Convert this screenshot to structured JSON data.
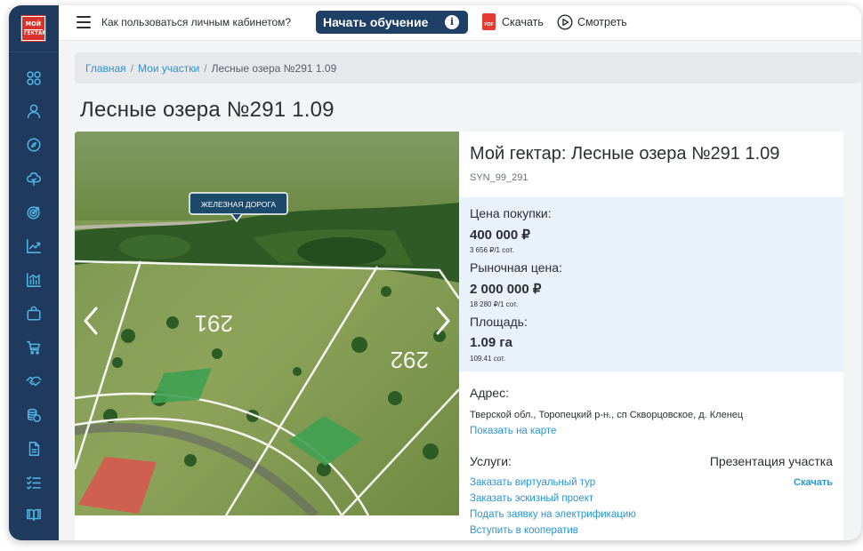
{
  "app": {
    "logo_line1": "МОЙ",
    "logo_line2": "ГЕКТАР",
    "brand_color": "#d9322b",
    "sidebar_color": "#1f3a5c",
    "accent_color": "#2a95d2"
  },
  "sidebar": {
    "items": [
      {
        "icon": "grid-icon"
      },
      {
        "icon": "user-icon"
      },
      {
        "icon": "compass-icon"
      },
      {
        "icon": "tree-icon"
      },
      {
        "icon": "target-icon"
      },
      {
        "icon": "line-chart-icon"
      },
      {
        "icon": "bar-chart-icon"
      },
      {
        "icon": "bag-icon"
      },
      {
        "icon": "cart-icon"
      },
      {
        "icon": "handshake-icon"
      },
      {
        "icon": "coins-icon"
      },
      {
        "icon": "document-icon"
      },
      {
        "icon": "checklist-icon"
      },
      {
        "icon": "book-icon"
      }
    ]
  },
  "topbar": {
    "help_text": "Как пользоваться личным кабинетом?",
    "start_label": "Начать обучение",
    "info_glyph": "i",
    "pdf_badge": "PDF",
    "download_label": "Скачать",
    "watch_label": "Смотреть"
  },
  "breadcrumb": {
    "home": "Главная",
    "my_plots": "Мои участки",
    "current": "Лесные озера №291 1.09",
    "separator": "/"
  },
  "page": {
    "title": "Лесные озера №291 1.09"
  },
  "photo": {
    "sign_label": "ЖЕЛЕЗНАЯ ДОРОГА",
    "plot_a": "291",
    "plot_b": "292"
  },
  "plot": {
    "title": "Мой гектар: Лесные озера №291 1.09",
    "code": "SYN_99_291",
    "purchase_price_label": "Цена покупки:",
    "purchase_price": "400 000 ₽",
    "purchase_per_unit": "3 656 ₽/1 сот.",
    "market_price_label": "Рыночная цена:",
    "market_price": "2 000 000 ₽",
    "market_per_unit": "18 280 ₽/1 сот.",
    "area_label": "Площадь:",
    "area": "1.09 га",
    "area_sub": "109.41 сот.",
    "address_label": "Адрес:",
    "address": "Тверской обл., Торопецкий р-н., сп Скворцовское, д. Кленец",
    "show_on_map": "Показать на карте",
    "services_label": "Услуги:",
    "services": [
      "Заказать виртуальный тур",
      "Заказать эскизный проект",
      "Подать заявку на электрификацию",
      "Вступить в кооператив"
    ],
    "presentation_label": "Презентация участка",
    "presentation_download": "Скачать"
  }
}
